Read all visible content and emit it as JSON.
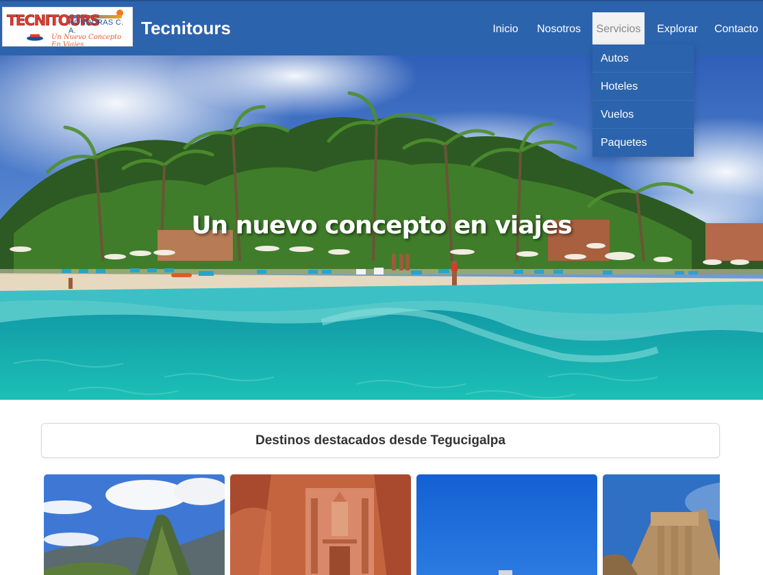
{
  "header": {
    "logo": {
      "main_text": "TECNITOURS",
      "sub_text": "HONDURAS C. A.",
      "tagline": "Un Nuevo Concepto En Viajes"
    },
    "brand": "Tecnitours"
  },
  "nav": {
    "items": [
      {
        "label": "Inicio"
      },
      {
        "label": "Nosotros"
      },
      {
        "label": "Servicios"
      },
      {
        "label": "Explorar"
      },
      {
        "label": "Contacto"
      }
    ],
    "active_item": "Servicios",
    "dropdown": {
      "items": [
        {
          "label": "Autos"
        },
        {
          "label": "Hoteles"
        },
        {
          "label": "Vuelos"
        },
        {
          "label": "Paquetes"
        }
      ]
    }
  },
  "hero": {
    "title": "Un nuevo concepto en viajes"
  },
  "featured": {
    "heading": "Destinos destacados desde Tegucigalpa",
    "cards": [
      {
        "image": "machu-picchu-mountain"
      },
      {
        "image": "petra-treasury"
      },
      {
        "image": "blue-sky-landmark"
      },
      {
        "image": "greek-ruins"
      }
    ]
  },
  "colors": {
    "navbar": "#2c63ad",
    "accent_red": "#e33b2e",
    "ocean": "#19a9b3"
  }
}
